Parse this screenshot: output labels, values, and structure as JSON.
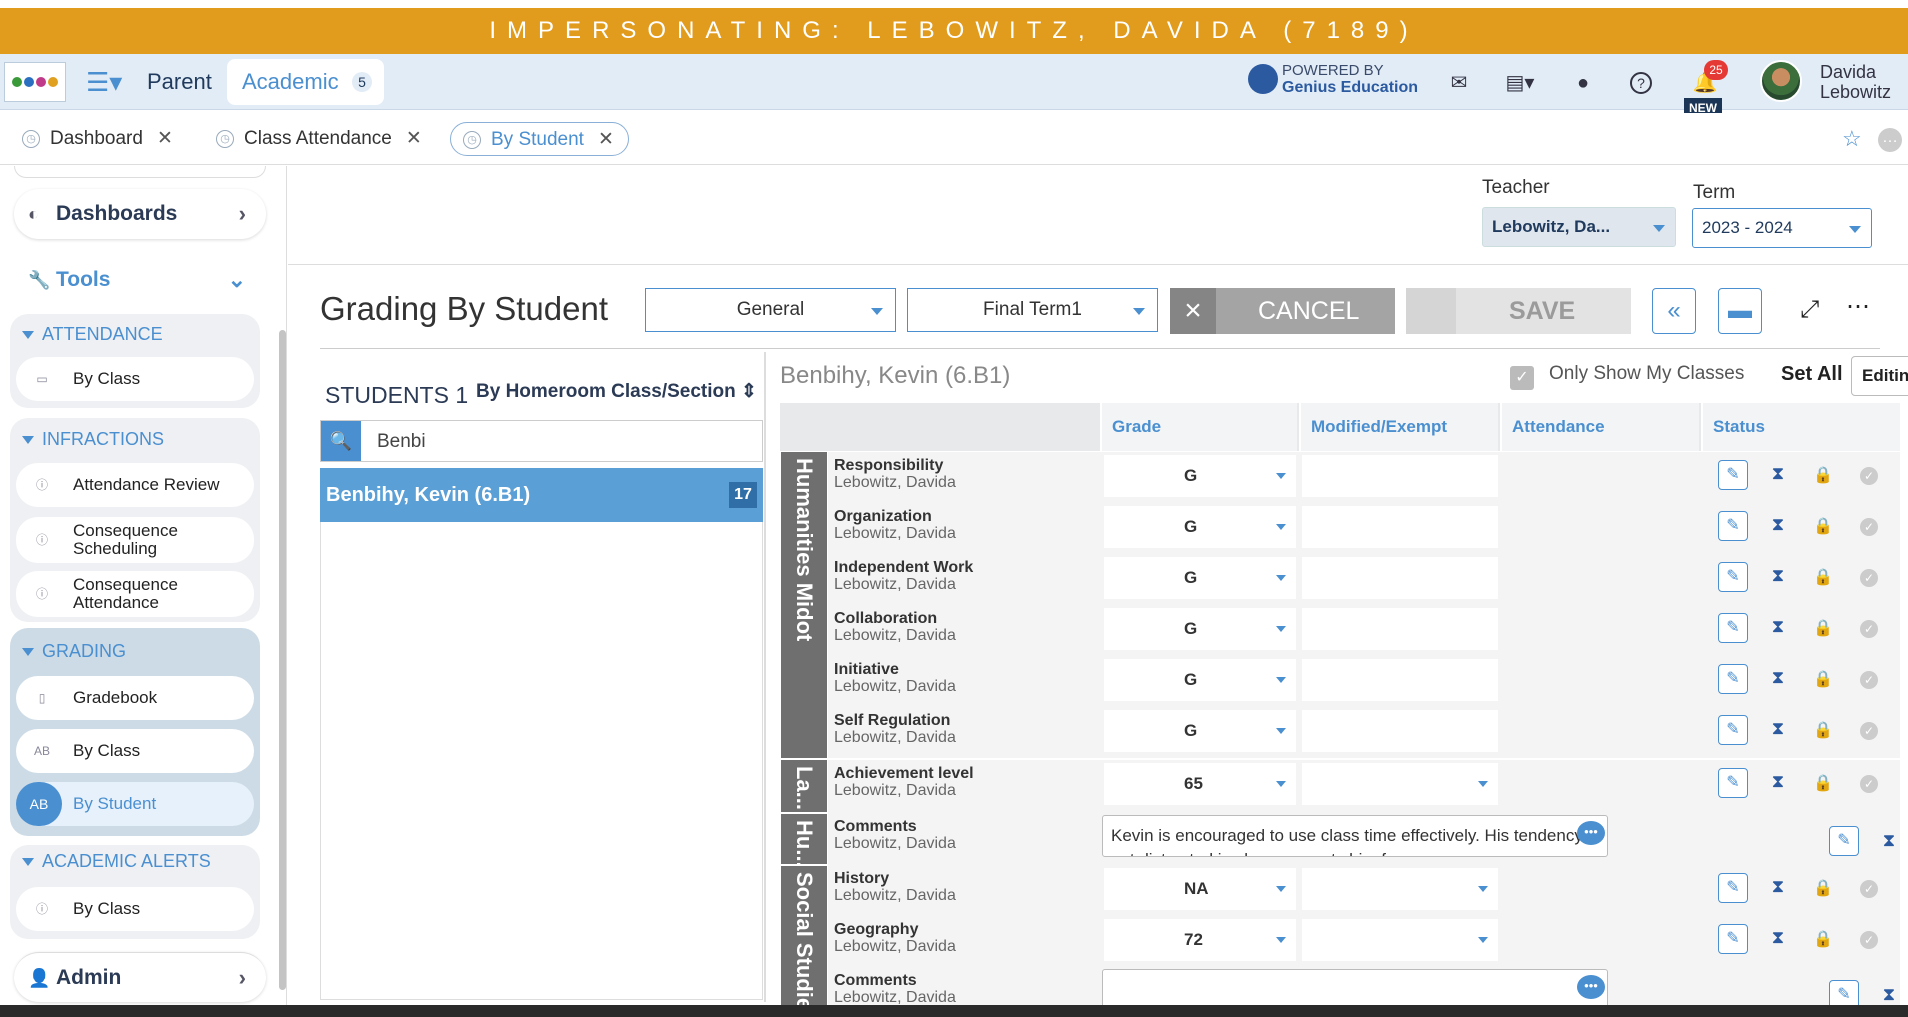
{
  "impersonation_banner": "IMPERSONATING: LEBOWITZ, DAVIDA (7189)",
  "header": {
    "nav_parent": "Parent",
    "nav_academic": "Academic",
    "academic_badge": "5",
    "powered_by": "POWERED BY",
    "powered_brand": "Genius Education",
    "notification_count": "25",
    "new_tag": "NEW",
    "user_first": "Davida",
    "user_last": "Lebowitz"
  },
  "tabs": [
    {
      "label": "Dashboard"
    },
    {
      "label": "Class Attendance"
    },
    {
      "label": "By Student"
    }
  ],
  "sidebar": {
    "dashboards": "Dashboards",
    "tools": "Tools",
    "admin": "Admin",
    "groups": {
      "attendance": {
        "label": "ATTENDANCE",
        "items": [
          "By Class"
        ]
      },
      "infractions": {
        "label": "INFRACTIONS",
        "items": [
          "Attendance Review",
          "Consequence Scheduling",
          "Consequence Attendance"
        ]
      },
      "grading": {
        "label": "GRADING",
        "items": [
          "Gradebook",
          "By Class",
          "By Student"
        ]
      },
      "academic_alerts": {
        "label": "ACADEMIC ALERTS",
        "items": [
          "By Class"
        ]
      }
    }
  },
  "filters": {
    "teacher_label": "Teacher",
    "teacher_value": "Lebowitz, Da...",
    "term_label": "Term",
    "term_value": "2023 - 2024"
  },
  "page": {
    "title": "Grading By Student",
    "dropdown1": "General",
    "dropdown2": "Final Term1",
    "cancel": "CANCEL",
    "save": "SAVE"
  },
  "students": {
    "heading": "STUDENTS",
    "count": "1",
    "group_by": "By Homeroom Class/Section",
    "search_value": "Benbi",
    "selected_name": "Benbihy, Kevin (6.B1)",
    "selected_count": "17"
  },
  "grid": {
    "student_title": "Benbihy, Kevin (6.B1)",
    "only_show_my_classes": "Only Show My Classes",
    "set_all": "Set All",
    "editing": "Editin",
    "columns": [
      "Grade",
      "Modified/Exempt",
      "Attendance",
      "Status"
    ],
    "sections": [
      "Humanities Midot",
      "La...",
      "Hu...",
      "Social Studie"
    ],
    "rows": [
      {
        "subject": "Responsibility",
        "teacher": "Lebowitz, Davida",
        "grade": "G"
      },
      {
        "subject": "Organization",
        "teacher": "Lebowitz, Davida",
        "grade": "G"
      },
      {
        "subject": "Independent Work",
        "teacher": "Lebowitz, Davida",
        "grade": "G"
      },
      {
        "subject": "Collaboration",
        "teacher": "Lebowitz, Davida",
        "grade": "G"
      },
      {
        "subject": "Initiative",
        "teacher": "Lebowitz, Davida",
        "grade": "G"
      },
      {
        "subject": "Self Regulation",
        "teacher": "Lebowitz, Davida",
        "grade": "G"
      },
      {
        "subject": "Achievement level",
        "teacher": "Lebowitz, Davida",
        "grade": "65"
      },
      {
        "subject": "Comments",
        "teacher": "Lebowitz, Davida",
        "comment": "Kevin is encouraged to use class time effectively. His tendency to get distracted in class prevents him from"
      },
      {
        "subject": "History",
        "teacher": "Lebowitz, Davida",
        "grade": "NA"
      },
      {
        "subject": "Geography",
        "teacher": "Lebowitz, Davida",
        "grade": "72"
      },
      {
        "subject": "Comments",
        "teacher": "Lebowitz, Davida",
        "comment": ""
      }
    ]
  }
}
